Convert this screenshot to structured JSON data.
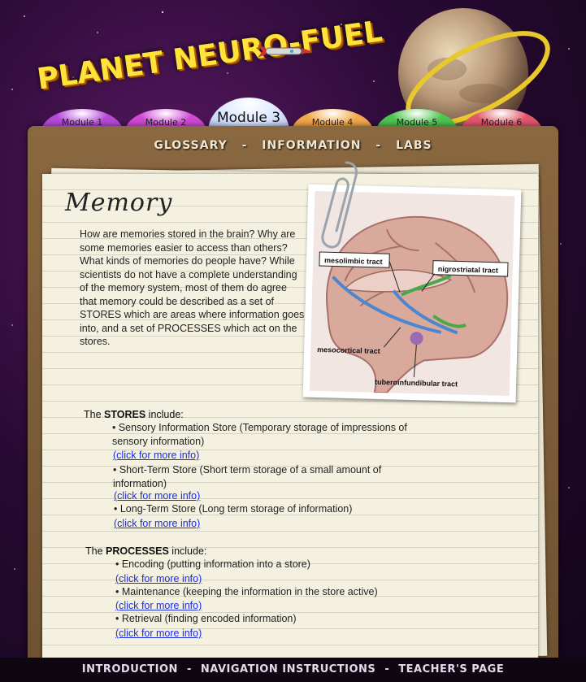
{
  "app": {
    "logo_text": "PLANET NEURO-FUEL"
  },
  "tabs": [
    {
      "label": "Module 1",
      "color": "#b64ad8"
    },
    {
      "label": "Module 2",
      "color": "#d04ad4"
    },
    {
      "label": "Module 3",
      "active": true,
      "color": "#ccd8ff"
    },
    {
      "label": "Module 4",
      "color": "#f3a84a"
    },
    {
      "label": "Module 5",
      "color": "#4fc44f"
    },
    {
      "label": "Module 6",
      "color": "#e2566a"
    }
  ],
  "topnav": {
    "glossary": "GLOSSARY",
    "information": "INFORMATION",
    "labs": "LABS",
    "sep": "-"
  },
  "page": {
    "title": "Memory",
    "intro": "How are memories stored in the brain? Why are some memories easier to access than others? What kinds of memories do people have? While scientists do not have a complete understanding of the memory system, most of them do agree that memory could be described as a set of STORES which are areas where information goes into, and a set of PROCESSES which act on the stores."
  },
  "brain_labels": {
    "mesolimbic": "mesolimbic tract",
    "nigrostriatal": "nigrostriatal tract",
    "mesocortical": "mesocortical tract",
    "tuberoinfundibular": "tuberoinfundibular tract"
  },
  "stores": {
    "prefix": "The ",
    "heading": "STORES",
    "suffix": " include:",
    "items": [
      "• Sensory Information Store (Temporary storage of impressions of sensory information)",
      "• Short-Term Store (Short term storage of a small amount of information)",
      "• Long-Term Store (Long term storage of information)"
    ]
  },
  "processes": {
    "prefix": "The ",
    "heading": "PROCESSES",
    "suffix": " include:",
    "items": [
      "• Encoding (putting information into a store)",
      "• Maintenance (keeping the information in the store active)",
      "• Retrieval (finding encoded information)"
    ]
  },
  "link_text": "(click for more info)",
  "footer": {
    "introduction": "INTRODUCTION",
    "navigation": "NAVIGATION INSTRUCTIONS",
    "teacher": "TEACHER'S PAGE",
    "sep": "-"
  }
}
